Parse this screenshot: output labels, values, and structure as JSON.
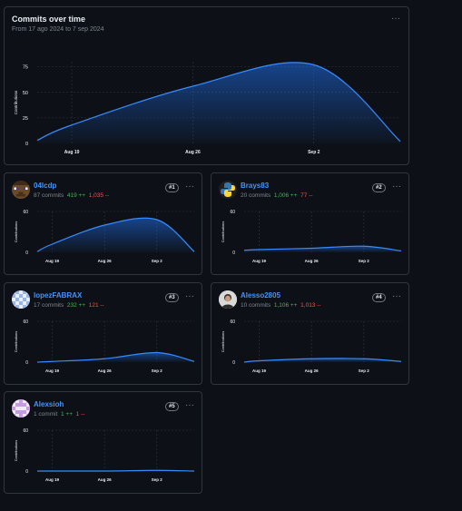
{
  "main": {
    "title": "Commits over time",
    "subtitle": "From 17 ago 2024 to 7 sep 2024",
    "chart_data": {
      "type": "area",
      "title": "Commits over time",
      "ylabel": "Contributions",
      "ylim": [
        0,
        80
      ],
      "y_ticks": [
        "0",
        "25",
        "50",
        "75"
      ],
      "x_ticks": [
        "Aug 19",
        "Aug 26",
        "Sep 2"
      ],
      "x": [
        "2024-08-17",
        "2024-08-19",
        "2024-08-26",
        "2024-09-02",
        "2024-09-07"
      ],
      "values": [
        3,
        18,
        56,
        77,
        2
      ],
      "colors": {
        "line": "#388bfd",
        "fill": "#1f6feb"
      }
    }
  },
  "contributors": [
    {
      "rank": "#1",
      "name": "04lcdp",
      "commits": "87 commits",
      "additions": "419 ++",
      "deletions": "1,035 --",
      "avatar_icon": "minecraft-face-icon",
      "chart_data": {
        "type": "area",
        "ylabel": "Contributions",
        "ylim": [
          0,
          60
        ],
        "y_ticks": [
          "0",
          "60"
        ],
        "x_ticks": [
          "Aug 19",
          "Aug 26",
          "Sep 2"
        ],
        "x": [
          "2024-08-17",
          "2024-08-19",
          "2024-08-26",
          "2024-09-02",
          "2024-09-07"
        ],
        "values": [
          1,
          12,
          40,
          48,
          1
        ]
      }
    },
    {
      "rank": "#2",
      "name": "Brays83",
      "commits": "20 commits",
      "additions": "1,006 ++",
      "deletions": "77 --",
      "avatar_icon": "python-logo-icon",
      "chart_data": {
        "type": "area",
        "ylabel": "Contributions",
        "ylim": [
          0,
          60
        ],
        "y_ticks": [
          "0",
          "60"
        ],
        "x_ticks": [
          "Aug 19",
          "Aug 26",
          "Sep 2"
        ],
        "x": [
          "2024-08-17",
          "2024-08-19",
          "2024-08-26",
          "2024-09-02",
          "2024-09-07"
        ],
        "values": [
          3,
          4,
          6,
          9,
          2
        ]
      }
    },
    {
      "rank": "#3",
      "name": "lopezFABRAX",
      "commits": "17 commits",
      "additions": "232 ++",
      "deletions": "121 --",
      "avatar_icon": "identicon-blue-icon",
      "chart_data": {
        "type": "area",
        "ylabel": "Contributions",
        "ylim": [
          0,
          60
        ],
        "y_ticks": [
          "0",
          "60"
        ],
        "x_ticks": [
          "Aug 19",
          "Aug 26",
          "Sep 2"
        ],
        "x": [
          "2024-08-17",
          "2024-08-19",
          "2024-08-26",
          "2024-09-02",
          "2024-09-07"
        ],
        "values": [
          0,
          1,
          5,
          14,
          1
        ]
      }
    },
    {
      "rank": "#4",
      "name": "Alesso2805",
      "commits": "10 commits",
      "additions": "1,106 ++",
      "deletions": "1,013 --",
      "avatar_icon": "user-photo-icon",
      "chart_data": {
        "type": "area",
        "ylabel": "Contributions",
        "ylim": [
          0,
          60
        ],
        "y_ticks": [
          "0",
          "60"
        ],
        "x_ticks": [
          "Aug 19",
          "Aug 26",
          "Sep 2"
        ],
        "x": [
          "2024-08-17",
          "2024-08-19",
          "2024-08-26",
          "2024-09-02",
          "2024-09-07"
        ],
        "values": [
          0,
          2,
          5,
          5,
          1
        ]
      }
    },
    {
      "rank": "#5",
      "name": "Alexsioh",
      "commits": "1 commit",
      "additions": "1 ++",
      "deletions": "1 --",
      "avatar_icon": "identicon-purple-icon",
      "chart_data": {
        "type": "area",
        "ylabel": "Contributions",
        "ylim": [
          0,
          60
        ],
        "y_ticks": [
          "0",
          "60"
        ],
        "x_ticks": [
          "Aug 19",
          "Aug 26",
          "Sep 2"
        ],
        "x": [
          "2024-08-17",
          "2024-08-19",
          "2024-08-26",
          "2024-09-02",
          "2024-09-07"
        ],
        "values": [
          0,
          0,
          0,
          1,
          0
        ]
      }
    }
  ]
}
